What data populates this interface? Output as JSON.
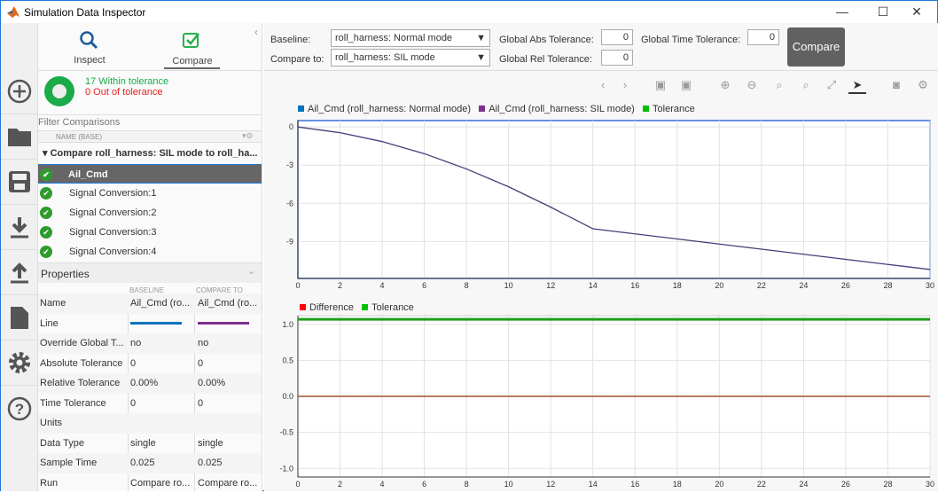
{
  "window": {
    "title": "Simulation Data Inspector",
    "minimize": "—",
    "maximize": "☐",
    "close": "✕"
  },
  "tabs": {
    "inspect": "Inspect",
    "compare": "Compare"
  },
  "summary": {
    "within": "17 Within tolerance",
    "out": "0 Out of tolerance"
  },
  "filter": {
    "label": "Filter Comparisons",
    "column": "NAME (BASE)"
  },
  "tree": {
    "group": "Compare roll_harness: SIL mode to roll_ha...",
    "items": [
      "Ail_Cmd",
      "Signal Conversion:1",
      "Signal Conversion:2",
      "Signal Conversion:3",
      "Signal Conversion:4"
    ]
  },
  "properties": {
    "title": "Properties",
    "col_baseline": "BASELINE",
    "col_compare": "COMPARE TO",
    "rows": [
      {
        "name": "Name",
        "base": "Ail_Cmd (ro...",
        "comp": "Ail_Cmd (ro..."
      },
      {
        "name": "Line",
        "base": "",
        "comp": ""
      },
      {
        "name": "Override Global T...",
        "base": "no",
        "comp": "no"
      },
      {
        "name": "Absolute Tolerance",
        "base": "0",
        "comp": "0"
      },
      {
        "name": "Relative Tolerance",
        "base": "0.00%",
        "comp": "0.00%"
      },
      {
        "name": "Time Tolerance",
        "base": "0",
        "comp": "0"
      },
      {
        "name": "Units",
        "base": "",
        "comp": ""
      },
      {
        "name": "Data Type",
        "base": "single",
        "comp": "single"
      },
      {
        "name": "Sample Time",
        "base": "0.025",
        "comp": "0.025"
      },
      {
        "name": "Run",
        "base": "Compare ro...",
        "comp": "Compare ro..."
      }
    ]
  },
  "colors": {
    "baseline": "#0072bd",
    "compare": "#7e2f8e",
    "tolerance": "#00c000",
    "difference": "#ff0000",
    "accent": "#1e7ad6"
  },
  "toolbar": {
    "baseline_label": "Baseline:",
    "baseline_value": "roll_harness: Normal mode",
    "compare_label": "Compare to:",
    "compare_value": "roll_harness: SIL mode",
    "abs_label": "Global Abs Tolerance:",
    "abs_value": "0",
    "rel_label": "Global Rel Tolerance:",
    "rel_value": "0",
    "time_label": "Global Time Tolerance:",
    "time_value": "0",
    "compare_button": "Compare"
  },
  "chart_data": [
    {
      "type": "line",
      "legend": [
        "Ail_Cmd (roll_harness: Normal mode)",
        "Ail_Cmd (roll_harness: SIL mode)",
        "Tolerance"
      ],
      "xlim": [
        0,
        30
      ],
      "ylim": [
        -11.9,
        0.5
      ],
      "xticks": [
        0,
        2,
        4,
        6,
        8,
        10,
        12,
        14,
        16,
        18,
        20,
        22,
        24,
        26,
        28,
        30
      ],
      "yticks": [
        0,
        -3,
        -6,
        -9
      ],
      "series": [
        {
          "name": "Ail_Cmd (roll_harness: SIL mode)",
          "x": [
            0,
            2,
            4,
            6,
            8,
            10,
            12,
            14,
            16,
            18,
            20,
            22,
            24,
            26,
            28,
            30
          ],
          "y": [
            0,
            -0.45,
            -1.15,
            -2.1,
            -3.3,
            -4.7,
            -6.3,
            -8.0,
            -8.4,
            -8.8,
            -9.2,
            -9.6,
            -10.0,
            -10.4,
            -10.8,
            -11.2
          ]
        }
      ]
    },
    {
      "type": "line",
      "legend": [
        "Difference",
        "Tolerance"
      ],
      "xlim": [
        0,
        30
      ],
      "ylim": [
        -1.12,
        1.12
      ],
      "xticks": [
        0,
        2,
        4,
        6,
        8,
        10,
        12,
        14,
        16,
        18,
        20,
        22,
        24,
        26,
        28,
        30
      ],
      "yticks": [
        1.0,
        0.5,
        0,
        -0.5,
        -1.0
      ],
      "series": [
        {
          "name": "Difference",
          "x": [
            0,
            30
          ],
          "y": [
            0,
            0
          ]
        },
        {
          "name": "Tolerance",
          "x": [
            0,
            30
          ],
          "y": [
            1.07,
            1.07
          ]
        }
      ]
    }
  ]
}
